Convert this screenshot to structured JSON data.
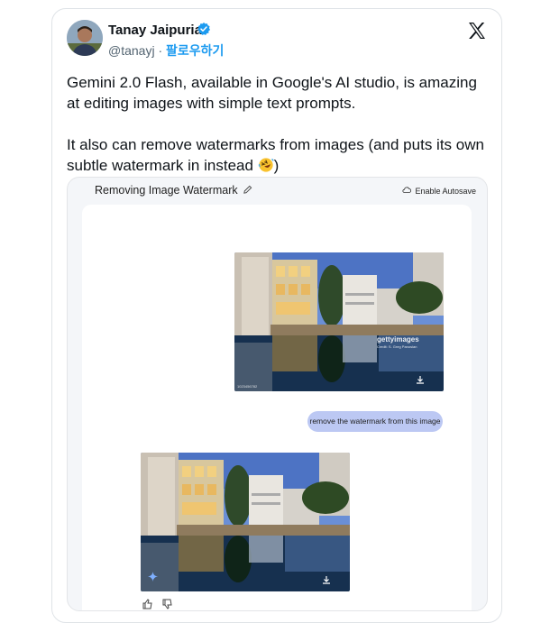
{
  "author": {
    "name": "Tanay Jaipuria",
    "handle": "@tanayj",
    "separator": "·",
    "follow_label": "팔로우하기"
  },
  "tweet": {
    "paragraph_1": "Gemini 2.0 Flash, available in Google's AI studio, is amazing at editing images with simple text prompts.",
    "paragraph_2": "It also can remove watermarks from images (and puts its own subtle watermark in instead",
    "paragraph_2_end": ")",
    "emoji": "rolling-on-floor-laughing-emoji"
  },
  "embedded_app": {
    "title": "Removing Image Watermark",
    "autosave_label": "Enable Autosave",
    "user_prompt": "remove the watermark from this image",
    "watermark_brand": "gettyimages",
    "watermark_credit": "Credit: S. Greg Panosian",
    "photo_id": "1023456782"
  },
  "colors": {
    "verified": "#1d9bf0",
    "follow": "#1d9bf0",
    "user_bubble": "#bcc8f3",
    "app_background": "#f4f6f9"
  },
  "icons": [
    "verified-badge-icon",
    "x-logo-icon",
    "pencil-icon",
    "autosave-icon",
    "sparkle-icon",
    "download-icon",
    "thumbs-up-icon",
    "thumbs-down-icon"
  ]
}
